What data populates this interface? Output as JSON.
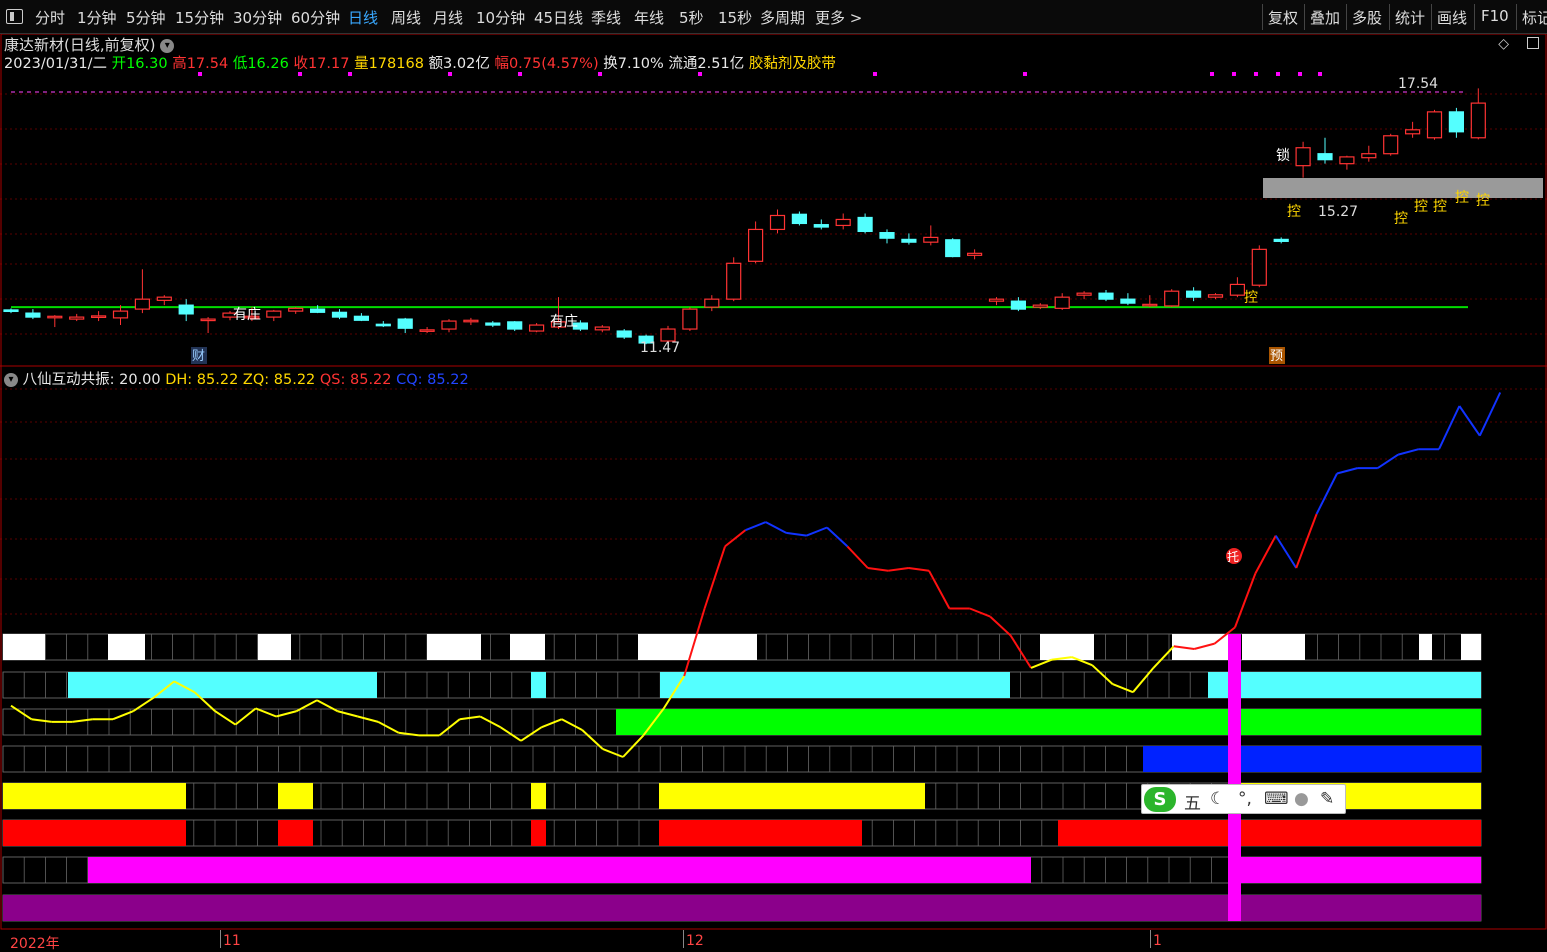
{
  "toolbar": {
    "periods": [
      "分时",
      "1分钟",
      "5分钟",
      "15分钟",
      "30分钟",
      "60分钟",
      "日线",
      "周线",
      "月线",
      "10分钟",
      "45日线",
      "季线",
      "年线",
      "5秒",
      "15秒",
      "多周期",
      "更多 >"
    ],
    "active_period": "日线",
    "right_tools": [
      "复权",
      "叠加",
      "多股",
      "统计",
      "画线",
      "F10",
      "标记"
    ]
  },
  "stock": {
    "title": "康达新材(日线,前复权)",
    "date": "2023/01/31/二",
    "open_label": "开",
    "open": "16.30",
    "high_label": "高",
    "high": "17.54",
    "low_label": "低",
    "low": "16.26",
    "close_label": "收",
    "close": "17.17",
    "volume_label": "量",
    "volume": "178168",
    "amount_label": "额",
    "amount": "3.02亿",
    "change_label": "幅",
    "change": "0.75(4.57%)",
    "turnover_label": "换",
    "turnover": "7.10%",
    "float_label": "流通",
    "float": "2.51亿",
    "sector": "胶黏剂及胶带"
  },
  "price_annotations": {
    "high_label": "17.54",
    "low_label": "11.47",
    "level_label": "15.27",
    "youzhuang": "有庄",
    "kong": "控",
    "suo": "锁",
    "cai": "财",
    "yu": "预"
  },
  "indicator": {
    "name": "八仙互动共振",
    "param": ": 20.00",
    "dh": "DH: 85.22",
    "zq": "ZQ: 85.22",
    "qs": "QS: 85.22",
    "cq": "CQ: 85.22",
    "tuo": "托"
  },
  "date_axis": {
    "labels": [
      "2022年",
      "11",
      "12",
      "1"
    ]
  },
  "ime": {
    "logo": "S",
    "mode": "五",
    "punct": "°,",
    "keyboard": "⌨",
    "user": "●",
    "tool": "🔧"
  },
  "colors": {
    "up": "#ff3333",
    "down": "#54ffff",
    "ma": "#00dd00",
    "bg": "#000000",
    "magenta": "#ff00ff",
    "purple": "#8b008b"
  },
  "chart_data": {
    "type": "candlestick",
    "candles": [
      [
        11.98,
        12.02,
        11.9,
        11.95
      ],
      [
        11.9,
        12.0,
        11.75,
        11.8
      ],
      [
        11.8,
        11.85,
        11.55,
        11.82
      ],
      [
        11.75,
        11.88,
        11.7,
        11.8
      ],
      [
        11.82,
        11.95,
        11.7,
        11.83
      ],
      [
        11.78,
        12.1,
        11.6,
        11.95
      ],
      [
        12.0,
        13.0,
        11.9,
        12.25
      ],
      [
        12.22,
        12.35,
        12.1,
        12.3
      ],
      [
        12.1,
        12.25,
        11.7,
        11.88
      ],
      [
        11.75,
        11.8,
        11.4,
        11.75
      ],
      [
        11.8,
        11.95,
        11.72,
        11.9
      ],
      [
        11.78,
        12.05,
        11.7,
        11.82
      ],
      [
        11.8,
        11.98,
        11.7,
        11.95
      ],
      [
        11.95,
        12.05,
        11.88,
        12.02
      ],
      [
        12.0,
        12.1,
        11.9,
        11.92
      ],
      [
        11.92,
        12.0,
        11.75,
        11.8
      ],
      [
        11.82,
        11.9,
        11.7,
        11.72
      ],
      [
        11.62,
        11.7,
        11.55,
        11.6
      ],
      [
        11.75,
        11.78,
        11.4,
        11.52
      ],
      [
        11.45,
        11.55,
        11.4,
        11.48
      ],
      [
        11.5,
        11.75,
        11.42,
        11.7
      ],
      [
        11.7,
        11.78,
        11.6,
        11.72
      ],
      [
        11.65,
        11.7,
        11.55,
        11.6
      ],
      [
        11.68,
        11.7,
        11.45,
        11.5
      ],
      [
        11.45,
        11.65,
        11.42,
        11.6
      ],
      [
        11.55,
        12.3,
        11.5,
        11.68
      ],
      [
        11.65,
        11.72,
        11.45,
        11.5
      ],
      [
        11.48,
        11.6,
        11.42,
        11.55
      ],
      [
        11.45,
        11.5,
        11.25,
        11.3
      ],
      [
        11.32,
        11.36,
        11.12,
        11.15
      ],
      [
        11.2,
        11.58,
        11.15,
        11.5
      ],
      [
        11.5,
        12.05,
        11.45,
        12.0
      ],
      [
        12.05,
        12.35,
        11.95,
        12.25
      ],
      [
        12.25,
        13.3,
        12.2,
        13.15
      ],
      [
        13.2,
        14.2,
        13.15,
        14.0
      ],
      [
        14.0,
        14.5,
        13.9,
        14.35
      ],
      [
        14.38,
        14.45,
        14.1,
        14.15
      ],
      [
        14.12,
        14.25,
        14.0,
        14.06
      ],
      [
        14.1,
        14.4,
        14.0,
        14.25
      ],
      [
        14.3,
        14.4,
        13.9,
        13.95
      ],
      [
        13.92,
        14.0,
        13.65,
        13.78
      ],
      [
        13.75,
        13.9,
        13.62,
        13.68
      ],
      [
        13.68,
        14.1,
        13.6,
        13.8
      ],
      [
        13.74,
        13.78,
        13.3,
        13.32
      ],
      [
        13.35,
        13.5,
        13.25,
        13.4
      ],
      [
        12.2,
        12.3,
        12.1,
        12.25
      ],
      [
        12.2,
        12.3,
        11.95,
        12.0
      ],
      [
        12.05,
        12.15,
        12.0,
        12.1
      ],
      [
        12.02,
        12.4,
        11.98,
        12.3
      ],
      [
        12.35,
        12.45,
        12.25,
        12.4
      ],
      [
        12.4,
        12.48,
        12.2,
        12.25
      ],
      [
        12.25,
        12.4,
        12.1,
        12.15
      ],
      [
        12.1,
        12.35,
        12.05,
        12.12
      ],
      [
        12.08,
        12.5,
        12.05,
        12.45
      ],
      [
        12.45,
        12.55,
        12.2,
        12.3
      ],
      [
        12.3,
        12.4,
        12.25,
        12.36
      ],
      [
        12.35,
        12.8,
        12.3,
        12.62
      ],
      [
        12.6,
        13.6,
        12.55,
        13.5
      ],
      [
        13.75,
        13.8,
        13.65,
        13.7
      ],
      [
        15.6,
        16.2,
        15.3,
        16.05
      ],
      [
        15.9,
        16.3,
        15.65,
        15.75
      ],
      [
        15.65,
        15.85,
        15.5,
        15.82
      ],
      [
        15.8,
        16.1,
        15.7,
        15.9
      ],
      [
        15.9,
        16.4,
        15.85,
        16.35
      ],
      [
        16.4,
        16.7,
        16.3,
        16.5
      ],
      [
        16.3,
        17.0,
        16.25,
        16.95
      ],
      [
        16.95,
        17.05,
        16.3,
        16.45
      ],
      [
        16.3,
        17.54,
        16.26,
        17.17
      ]
    ],
    "ma_level": 12.05,
    "price_high": 17.54,
    "price_low": 11.47,
    "indicator_line": [
      19,
      14,
      13,
      13,
      14,
      14,
      17,
      22,
      28,
      24,
      17,
      12,
      18,
      15,
      17,
      21,
      17,
      15,
      13,
      9,
      8,
      8,
      14,
      15,
      11,
      6,
      11,
      14,
      10,
      3,
      0,
      8,
      18,
      30,
      55,
      78,
      84,
      87,
      83,
      82,
      85,
      78,
      70,
      69,
      70,
      69,
      55,
      55,
      52,
      45,
      33,
      36,
      37,
      34,
      27,
      24,
      33,
      41,
      40,
      42,
      48,
      68,
      82,
      70,
      90,
      105,
      107,
      107,
      112,
      114,
      114,
      130,
      119,
      135
    ],
    "title": "",
    "xlabel": "",
    "ylabel": ""
  }
}
